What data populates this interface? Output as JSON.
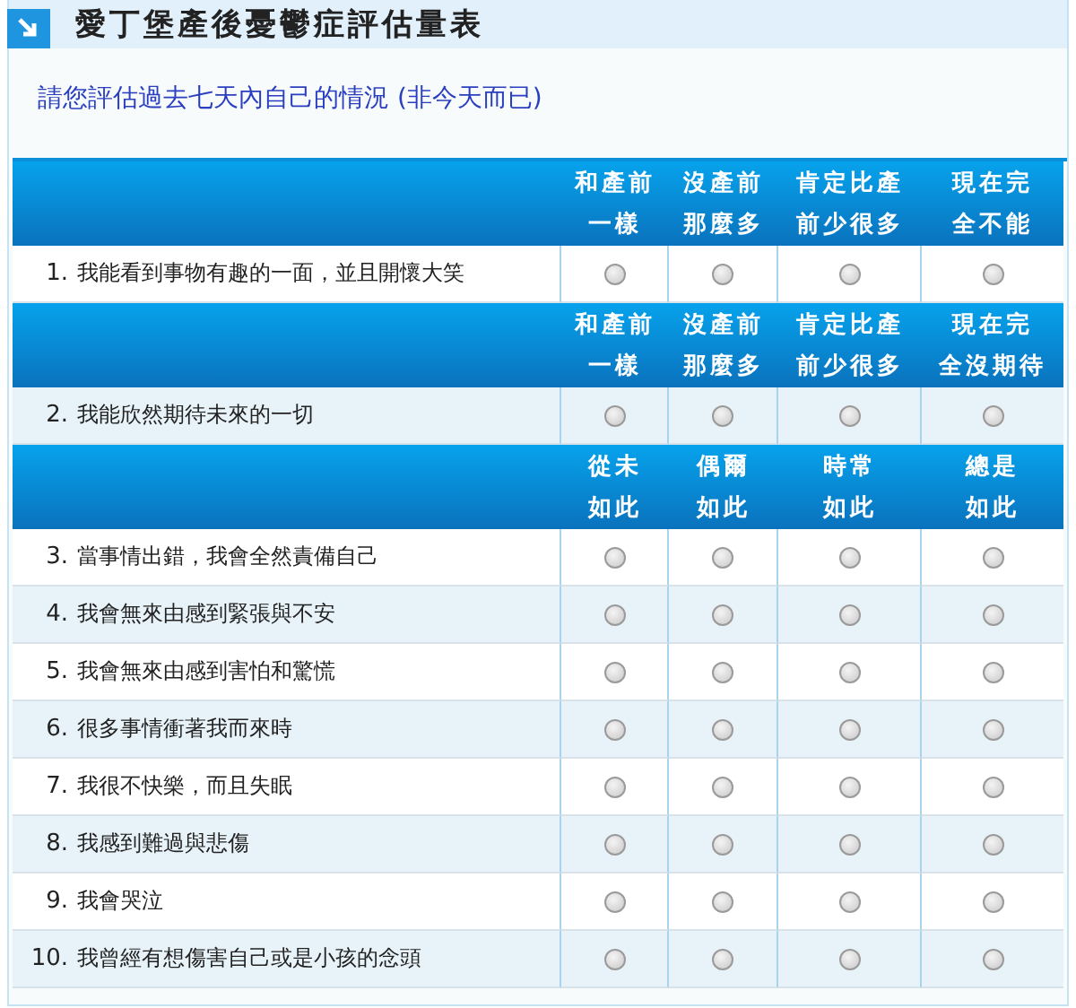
{
  "title": "愛丁堡產後憂鬱症評估量表",
  "instruction": "請您評估過去七天內自己的情況 (非今天而已)",
  "sections": [
    {
      "header": [
        "和產前一樣",
        "沒產前那麼多",
        "肯定比產前少很多",
        "現在完全不能"
      ],
      "questions": [
        {
          "number": "1.",
          "text": "我能看到事物有趣的一面，並且開懷大笑",
          "options": [
            {
              "selected": false
            },
            {
              "selected": false
            },
            {
              "selected": false
            },
            {
              "selected": false
            }
          ]
        }
      ]
    },
    {
      "header": [
        "和產前一樣",
        "沒產前那麼多",
        "肯定比產前少很多",
        "現在完全沒期待"
      ],
      "questions": [
        {
          "number": "2.",
          "text": "我能欣然期待未來的一切",
          "options": [
            {
              "selected": false
            },
            {
              "selected": false
            },
            {
              "selected": false
            },
            {
              "selected": false
            }
          ]
        }
      ]
    },
    {
      "header": [
        "從未如此",
        "偶爾如此",
        "時常如此",
        "總是如此"
      ],
      "questions": [
        {
          "number": "3.",
          "text": "當事情出錯，我會全然責備自己",
          "options": [
            {
              "selected": false
            },
            {
              "selected": false
            },
            {
              "selected": false
            },
            {
              "selected": false
            }
          ]
        },
        {
          "number": "4.",
          "text": "我會無來由感到緊張與不安",
          "options": [
            {
              "selected": false
            },
            {
              "selected": false
            },
            {
              "selected": false
            },
            {
              "selected": false
            }
          ]
        },
        {
          "number": "5.",
          "text": "我會無來由感到害怕和驚慌",
          "options": [
            {
              "selected": false
            },
            {
              "selected": false
            },
            {
              "selected": false
            },
            {
              "selected": false
            }
          ]
        },
        {
          "number": "6.",
          "text": "很多事情衝著我而來時",
          "options": [
            {
              "selected": false
            },
            {
              "selected": false
            },
            {
              "selected": false
            },
            {
              "selected": false
            }
          ]
        },
        {
          "number": "7.",
          "text": "我很不快樂，而且失眠",
          "options": [
            {
              "selected": false
            },
            {
              "selected": false
            },
            {
              "selected": false
            },
            {
              "selected": false
            }
          ]
        },
        {
          "number": "8.",
          "text": "我感到難過與悲傷",
          "options": [
            {
              "selected": false
            },
            {
              "selected": false
            },
            {
              "selected": false
            },
            {
              "selected": false
            }
          ]
        },
        {
          "number": "9.",
          "text": "我會哭泣",
          "options": [
            {
              "selected": false
            },
            {
              "selected": false
            },
            {
              "selected": false
            },
            {
              "selected": false
            }
          ]
        },
        {
          "number": "10.",
          "text": "我曾經有想傷害自己或是小孩的念頭",
          "options": [
            {
              "selected": false
            },
            {
              "selected": false
            },
            {
              "selected": false
            },
            {
              "selected": false
            }
          ]
        }
      ]
    }
  ]
}
